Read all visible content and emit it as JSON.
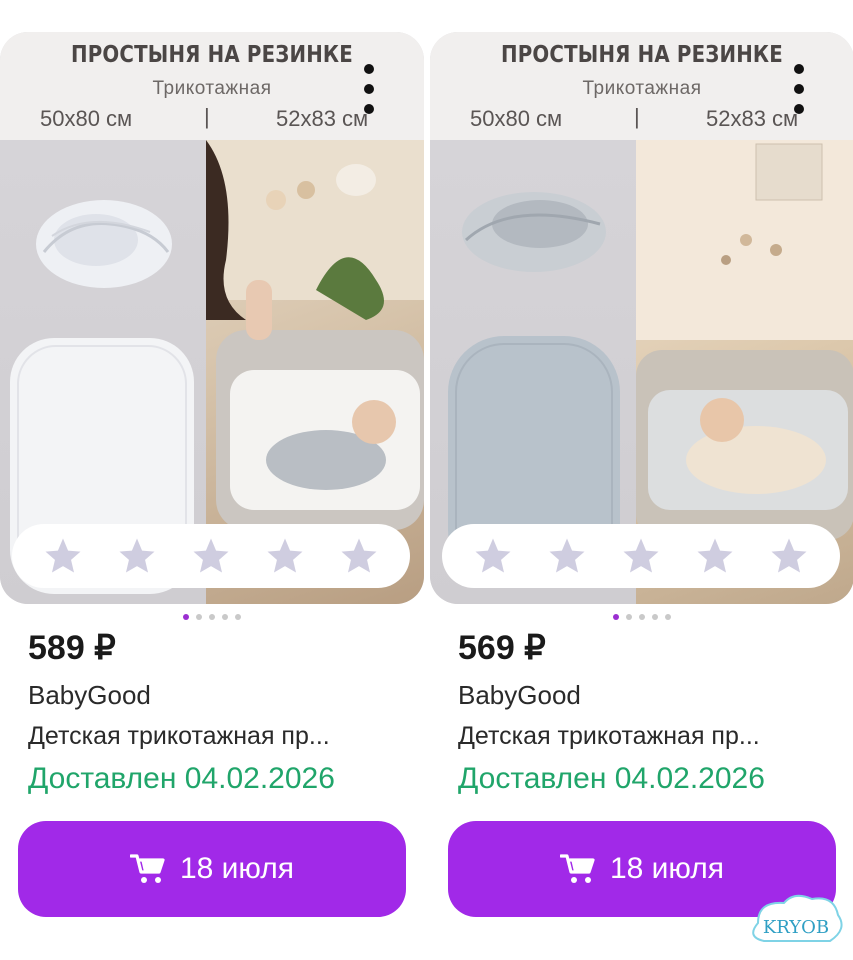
{
  "products": [
    {
      "banner": {
        "title": "ПРОСТЫНЯ НА РЕЗИНКЕ",
        "subtitle": "Трикотажная",
        "size_a": "50х80 см",
        "separator": "|",
        "size_b": "52х83 см"
      },
      "rating_stars": 5,
      "image_pager": {
        "count": 5,
        "active": 0
      },
      "price": "589 ₽",
      "brand": "BabyGood",
      "title": "Детская трикотажная пр...",
      "delivery": "Доставлен 04.02.2026",
      "cart_button_label": "18 июля"
    },
    {
      "banner": {
        "title": "ПРОСТЫНЯ НА РЕЗИНКЕ",
        "subtitle": "Трикотажная",
        "size_a": "50х80 см",
        "separator": "|",
        "size_b": "52х83 см"
      },
      "rating_stars": 5,
      "image_pager": {
        "count": 5,
        "active": 0
      },
      "price": "569 ₽",
      "brand": "BabyGood",
      "title": "Детская трикотажная пр...",
      "delivery": "Доставлен 04.02.2026",
      "cart_button_label": "18 июля"
    }
  ],
  "watermark": "KRYOB",
  "colors": {
    "accent": "#a129e8",
    "delivered": "#20a56a",
    "pager_active": "#9b2fd1",
    "star": "#cfcde0"
  },
  "icons": [
    "more-vertical-icon",
    "star-icon",
    "cart-icon"
  ]
}
